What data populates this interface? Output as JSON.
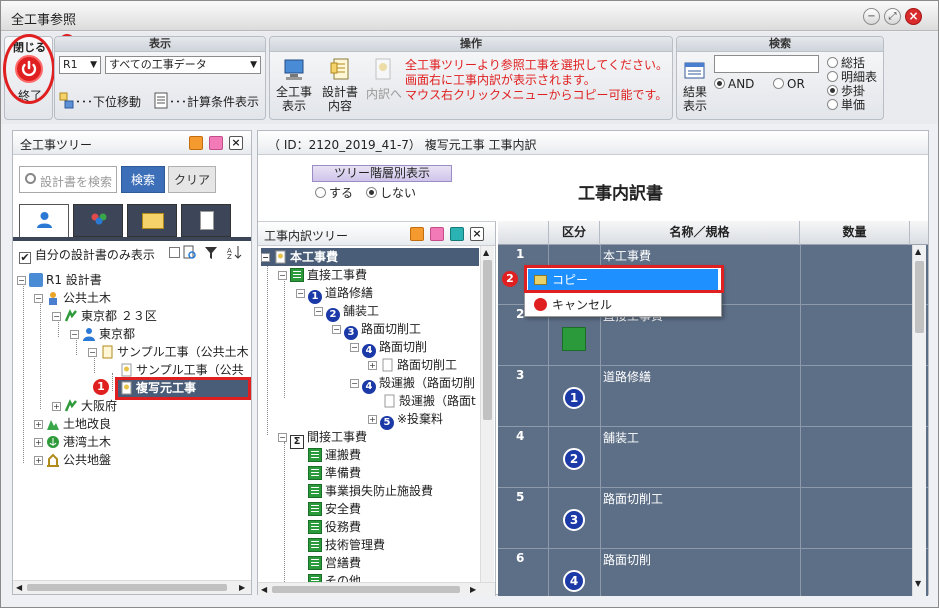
{
  "window": {
    "title": "全工事参照"
  },
  "ribbon": {
    "close_group": {
      "header": "閉じる",
      "button_label": "終了"
    },
    "display_group": {
      "header": "表示",
      "year_select": "R1",
      "data_select": "すべての工事データ",
      "move_down_label": "･･･下位移動",
      "calc_label": "･･･計算条件表示"
    },
    "operation_group": {
      "header": "操作",
      "work_display": "全工事\n表示",
      "design_content": "設計書\n内容",
      "to_breakdown": "内訳へ",
      "instructions": [
        "全工事ツリーより参照工事を選択してください。",
        "画面右に工事内訳が表示されます。",
        "マウス右クリックメニューからコピー可能です。"
      ]
    },
    "search_group": {
      "header": "検索",
      "result_display": "結果\n表示",
      "search_value": "",
      "and_label": "AND",
      "or_label": "OR",
      "options": [
        "総括",
        "明細表",
        "歩掛",
        "単価"
      ],
      "selected_option": "歩掛"
    }
  },
  "left_panel": {
    "title": "全工事ツリー",
    "search_placeholder": "設計書を検索",
    "search_button": "検索",
    "clear_button": "クリア",
    "own_only_label": "自分の設計書のみ表示",
    "tree": [
      {
        "label": "R1 設計書"
      },
      {
        "label": "公共土木"
      },
      {
        "label": "東京都 ２３区"
      },
      {
        "label": "東京都"
      },
      {
        "label": "サンプル工事（公共土木"
      },
      {
        "label": "サンプル工事（公共"
      },
      {
        "label": "複写元工事"
      },
      {
        "label": "大阪府"
      },
      {
        "label": "土地改良"
      },
      {
        "label": "港湾土木"
      },
      {
        "label": "公共地盤"
      }
    ]
  },
  "right_area": {
    "id_line": "（ ID：2120_2019_41-7） 複写元工事 工事内訳",
    "tree_toggle_label": "ツリー階層別表示",
    "radio_do": "する",
    "radio_dont": "しない",
    "title": "工事内訳書"
  },
  "breakdown_tree": {
    "title": "工事内訳ツリー",
    "items": [
      {
        "label": "本工事費"
      },
      {
        "label": "直接工事費"
      },
      {
        "label": "道路修繕",
        "num": "1"
      },
      {
        "label": "舗装工",
        "num": "2"
      },
      {
        "label": "路面切削工",
        "num": "3"
      },
      {
        "label": "路面切削",
        "num": "4"
      },
      {
        "label": "路面切削工"
      },
      {
        "label": "殻運搬（路面切削",
        "num": "4"
      },
      {
        "label": "殻運搬（路面t"
      },
      {
        "label": "※投棄料",
        "num": "5"
      },
      {
        "label": "間接工事費"
      },
      {
        "label": "運搬費"
      },
      {
        "label": "準備費"
      },
      {
        "label": "事業損失防止施設費"
      },
      {
        "label": "安全費"
      },
      {
        "label": "役務費"
      },
      {
        "label": "技術管理費"
      },
      {
        "label": "営繕費"
      },
      {
        "label": "その他"
      }
    ]
  },
  "table": {
    "headers": [
      "区分",
      "名称／規格",
      "数量"
    ],
    "rows": [
      {
        "no": "1",
        "name": "本工事費"
      },
      {
        "no": "2",
        "name": "直接工事費"
      },
      {
        "no": "3",
        "name": "道路修繕",
        "num": "1"
      },
      {
        "no": "4",
        "name": "舗装工",
        "num": "2"
      },
      {
        "no": "5",
        "name": "路面切削工",
        "num": "3"
      },
      {
        "no": "6",
        "name": "路面切削",
        "num": "4"
      }
    ]
  },
  "context_menu": {
    "copy": "コピー",
    "cancel": "キャンセル"
  },
  "callouts": {
    "one": "1",
    "two": "2",
    "three": "3"
  },
  "colors": {
    "table_bg": "#5d6f87",
    "highlight": "#1e90ff",
    "red": "#e02020",
    "tree_sel": "#4a5d78"
  }
}
